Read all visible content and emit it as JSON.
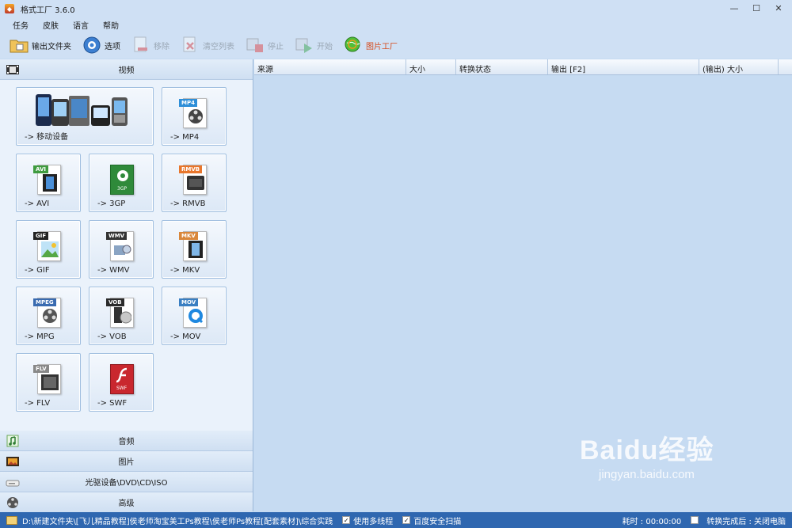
{
  "window": {
    "title": "格式工厂 3.6.0",
    "controls": {
      "minimize": "—",
      "maximize": "☐",
      "close": "✕"
    }
  },
  "menu": {
    "items": [
      "任务",
      "皮肤",
      "语言",
      "帮助"
    ]
  },
  "toolbar": {
    "output_folder": "输出文件夹",
    "options": "选项",
    "remove": "移除",
    "clear_list": "清空列表",
    "stop": "停止",
    "start": "开始",
    "picture_factory": "图片工厂"
  },
  "left_panel": {
    "video_section": "视频",
    "formats": {
      "mobile": "-> 移动设备",
      "mp4": "-> MP4",
      "avi": "-> AVI",
      "3gp": "-> 3GP",
      "rmvb": "-> RMVB",
      "gif": "-> GIF",
      "wmv": "-> WMV",
      "mkv": "-> MKV",
      "mpg": "-> MPG",
      "vob": "-> VOB",
      "mov": "-> MOV",
      "flv": "-> FLV",
      "swf": "-> SWF"
    },
    "format_tags": {
      "mp4": "MP4",
      "avi": "AVI",
      "3gp": "3GP",
      "rmvb": "RMVB",
      "gif": "GIF",
      "wmv": "WMV",
      "mkv": "MKV",
      "mpg": "MPEG",
      "vob": "VOB",
      "mov": "MOV",
      "flv": "FLV",
      "swf": "SWF"
    },
    "audio_section": "音频",
    "image_section": "图片",
    "disc_section": "光驱设备\\DVD\\CD\\ISO",
    "advanced_section": "高级"
  },
  "task_table": {
    "columns": [
      "来源",
      "大小",
      "转换状态",
      "输出 [F2]",
      "(输出) 大小"
    ]
  },
  "statusbar": {
    "output_path": "D:\\新建文件夹\\[飞儿精品教程]侯老师淘宝美工Ps教程\\侯老师Ps教程[配套素材]\\综合实践",
    "multithread_label": "使用多线程",
    "multithread_checked": true,
    "baidu_scan_label": "百度安全扫描",
    "baidu_scan_checked": true,
    "elapsed": "耗时 : 00:00:00",
    "after_done_label": "转换完成后 : 关闭电脑",
    "after_done_checked": false
  },
  "watermark": {
    "brand": "Baidu经验",
    "url": "jingyan.baidu.com"
  },
  "colors": {
    "statusbar": "#2f67b0",
    "panel": "#d8e7f7",
    "content": "#c6dbf2",
    "accent": "#d64a1a"
  }
}
